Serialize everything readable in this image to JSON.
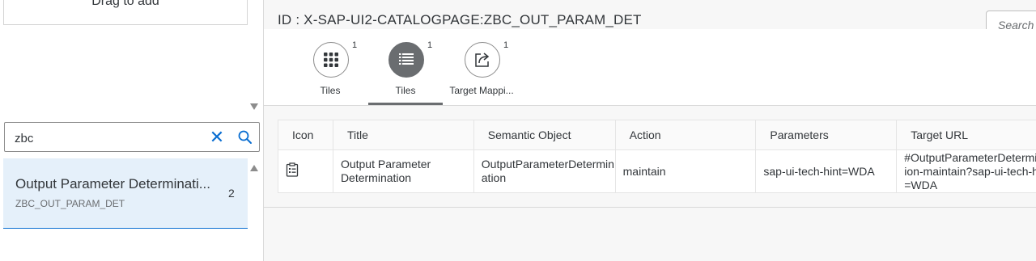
{
  "left": {
    "drag_text": "Drag to add",
    "search": {
      "value": "zbc"
    },
    "result": {
      "title": "Output Parameter Determinati...",
      "subtitle": "ZBC_OUT_PARAM_DET",
      "count": "2"
    }
  },
  "header": {
    "id_text": "ID : X-SAP-UI2-CATALOGPAGE:ZBC_OUT_PARAM_DET",
    "search_placeholder": "Search"
  },
  "tabs": [
    {
      "label": "Tiles",
      "count": "1",
      "icon": "grid-icon",
      "selected": false
    },
    {
      "label": "Tiles",
      "count": "1",
      "icon": "list-icon",
      "selected": true
    },
    {
      "label": "Target Mappi...",
      "count": "1",
      "icon": "share-icon",
      "selected": false
    }
  ],
  "table": {
    "columns": [
      "Icon",
      "Title",
      "Semantic Object",
      "Action",
      "Parameters",
      "Target URL"
    ],
    "rows": [
      {
        "icon": "checklist-icon",
        "title": "Output Parameter Determination",
        "semantic_object": "OutputParameterDetermination",
        "action": "maintain",
        "parameters": "sap-ui-tech-hint=WDA",
        "target_url": "#OutputParameterDetermination-maintain?sap-ui-tech-hint=WDA"
      }
    ]
  },
  "colors": {
    "accent": "#0a6ed1",
    "selected_bg": "#e5f0fa",
    "selected_tab": "#6a6d70"
  }
}
